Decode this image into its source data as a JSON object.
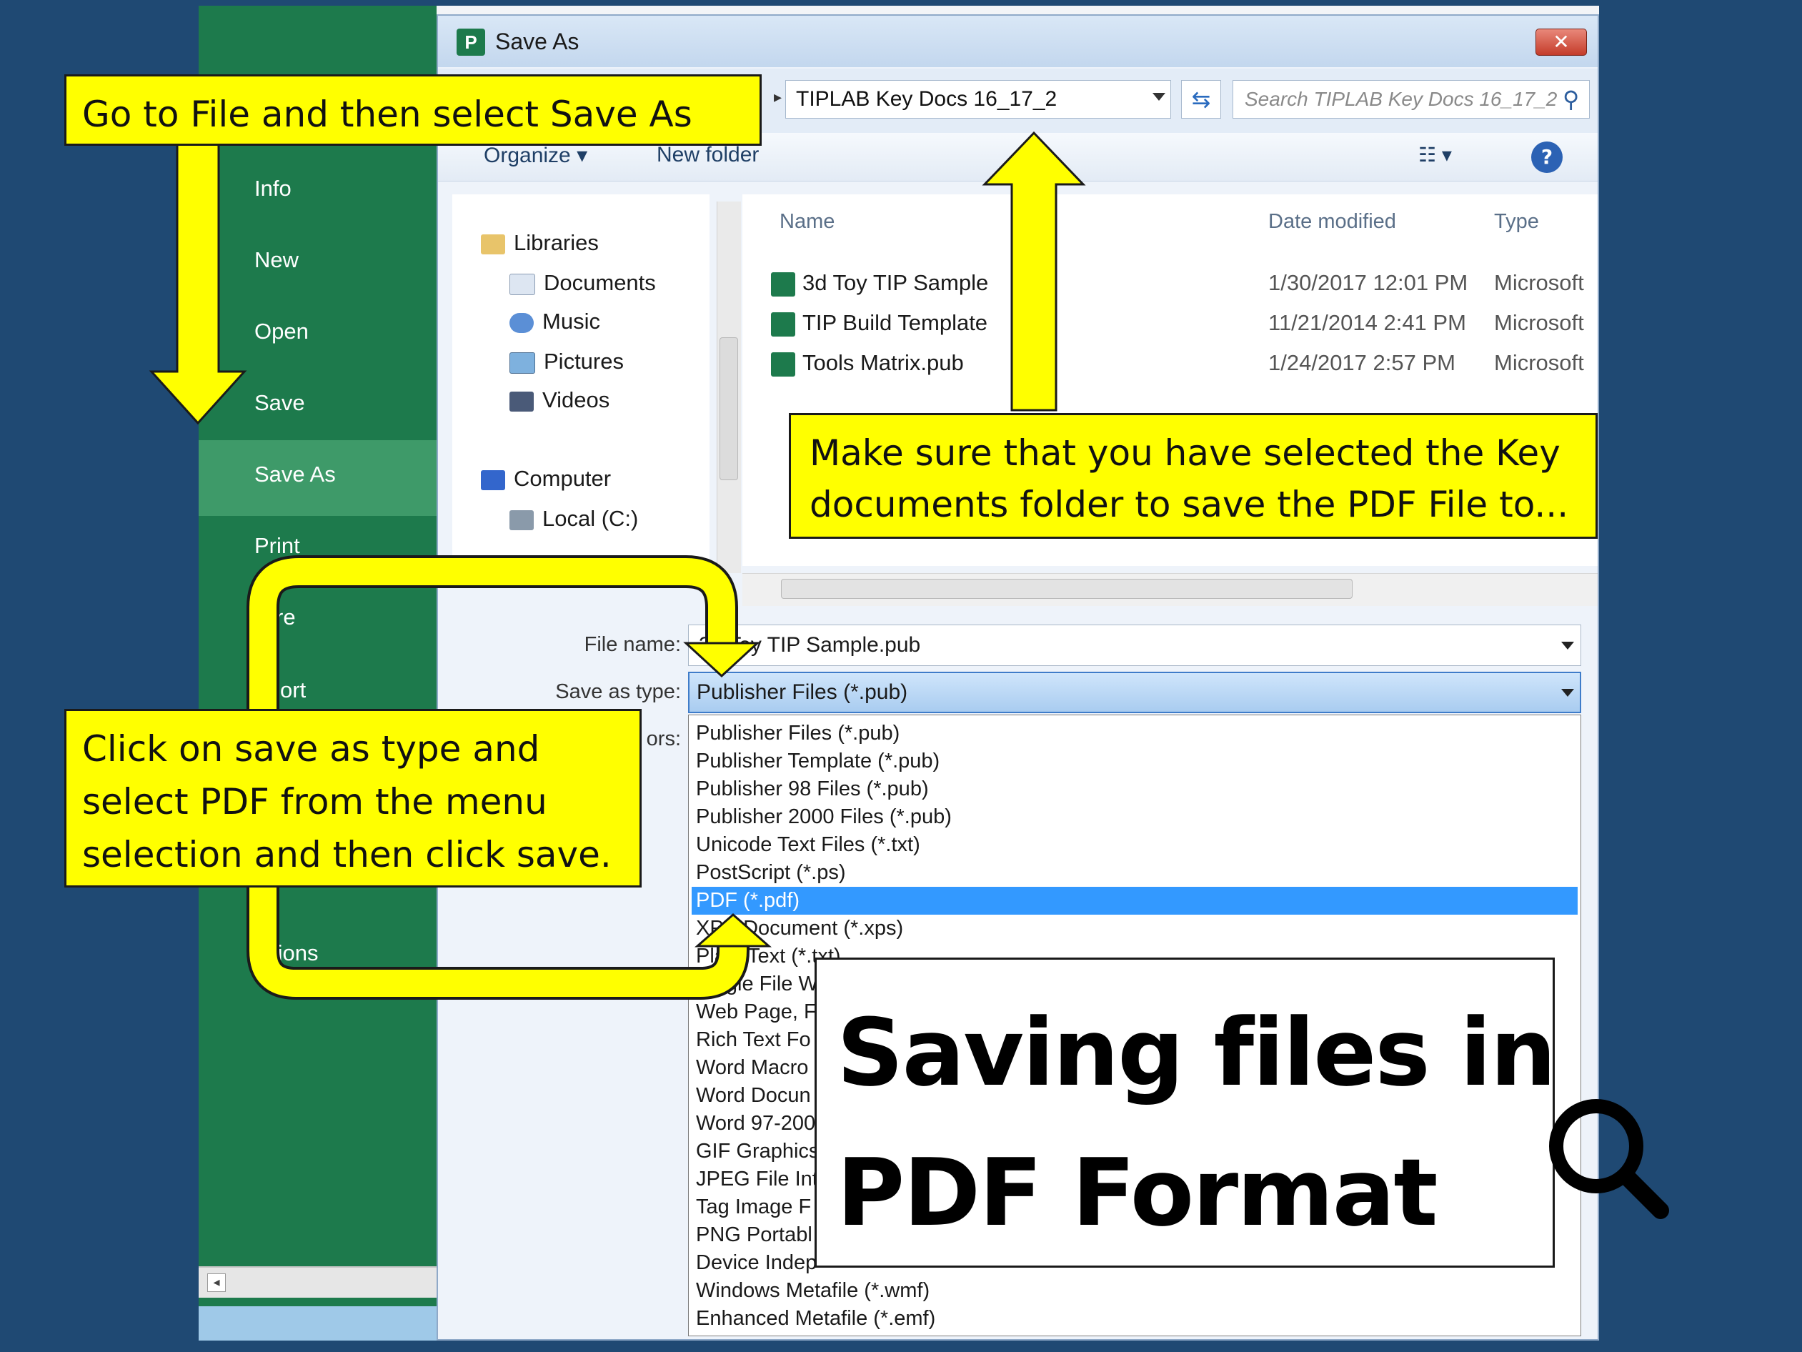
{
  "app": {
    "dialog_title": "Save As",
    "app_badge": "P"
  },
  "backstage": {
    "items": [
      "Info",
      "New",
      "Open",
      "Save",
      "Save As",
      "Print",
      "re",
      "ort",
      "tions"
    ],
    "selected": "Save As"
  },
  "address": {
    "path": "TIPLAB Key Docs 16_17_2",
    "search_placeholder": "Search TIPLAB Key Docs 16_17_2"
  },
  "toolbar": {
    "organize": "Organize",
    "new_folder": "New folder"
  },
  "nav": {
    "libraries": "Libraries",
    "documents": "Documents",
    "music": "Music",
    "pictures": "Pictures",
    "videos": "Videos",
    "computer": "Computer",
    "local": "Local (C:)"
  },
  "files": {
    "columns": {
      "name": "Name",
      "date": "Date modified",
      "type": "Type"
    },
    "rows": [
      {
        "name": "3d Toy TIP Sample",
        "date": "1/30/2017 12:01 PM",
        "type": "Microsoft"
      },
      {
        "name": "TIP Build Template",
        "date": "11/21/2014 2:41 PM",
        "type": "Microsoft"
      },
      {
        "name": "Tools Matrix.pub",
        "date": "1/24/2017 2:57 PM",
        "type": "Microsoft"
      }
    ]
  },
  "form": {
    "file_name_label": "File name:",
    "file_name_value": "3d Toy TIP Sample.pub",
    "save_type_label": "Save as type:",
    "save_type_value": "Publisher Files (*.pub)",
    "authors_label": "ors:"
  },
  "type_options": [
    "Publisher Files (*.pub)",
    "Publisher Template (*.pub)",
    "Publisher 98 Files (*.pub)",
    "Publisher 2000 Files (*.pub)",
    "Unicode Text Files (*.txt)",
    "PostScript (*.ps)",
    "PDF (*.pdf)",
    "XPS Document (*.xps)",
    "Plain Text (*.txt)",
    "Single File W",
    "Web Page, F",
    "Rich Text Fo",
    "Word Macro",
    "Word Docun",
    "Word 97-200",
    "GIF Graphics",
    "JPEG File Inte",
    "Tag Image F",
    "PNG Portabl",
    "Device Indep",
    "Windows Metafile (*.wmf)",
    "Enhanced Metafile (*.emf)"
  ],
  "selected_type": "PDF (*.pdf)",
  "callouts": {
    "step1": "Go to File and then select Save As",
    "step2_line1": "Make sure that you have selected the Key",
    "step2_line2": "documents folder to save the PDF File to...",
    "step3_line1": "Click on save as type and",
    "step3_line2": "select PDF from the menu",
    "step3_line3": "selection and then click save."
  },
  "slide_title": {
    "line1": "Saving files in",
    "line2": "PDF Format"
  },
  "colors": {
    "background": "#1f4973",
    "backstage_green": "#1d7a4c",
    "callout_yellow": "#ffff00",
    "selection_blue": "#3399ff"
  },
  "icons": [
    "publisher-app-icon",
    "close-icon",
    "refresh-icon",
    "search-icon",
    "help-icon",
    "view-options-icon",
    "library-icon",
    "documents-icon",
    "music-icon",
    "pictures-icon",
    "videos-icon",
    "computer-icon",
    "drive-icon",
    "publisher-file-icon",
    "magnifier-icon"
  ]
}
